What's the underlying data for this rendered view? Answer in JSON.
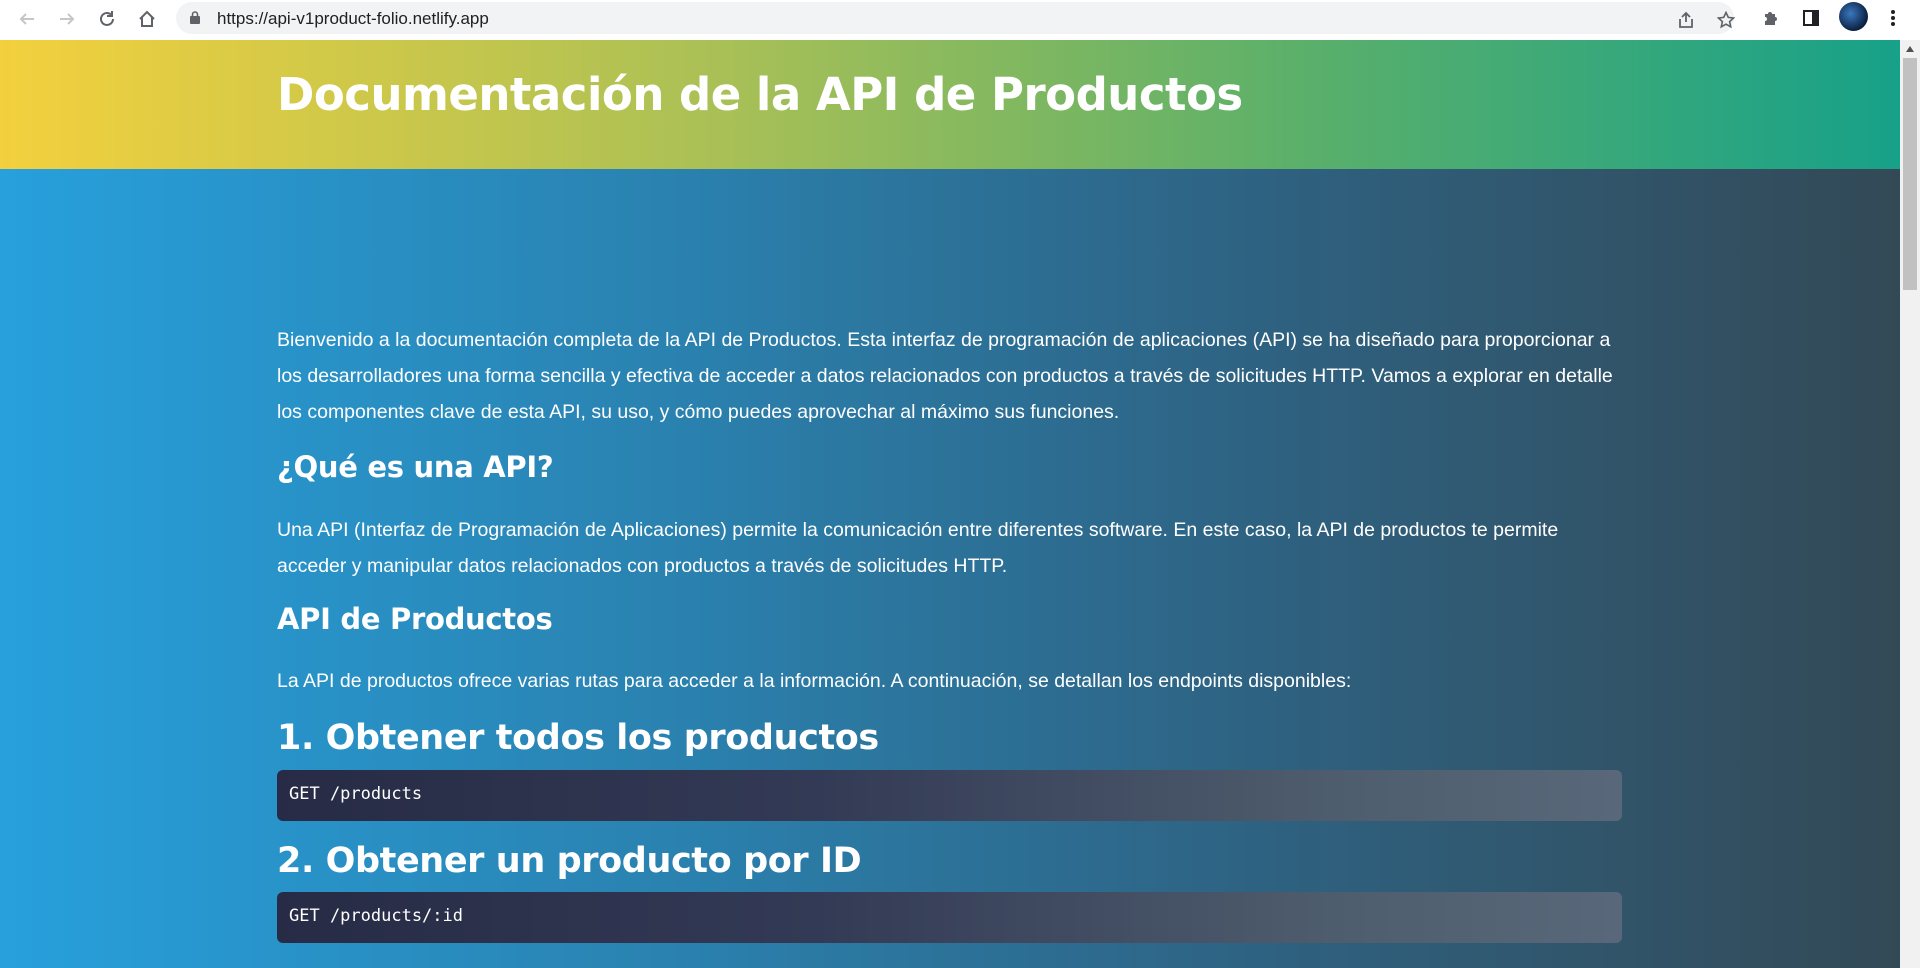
{
  "browser": {
    "url": "https://api-v1product-folio.netlify.app",
    "icons": {
      "back": "arrow-left-icon",
      "forward": "arrow-right-icon",
      "reload": "reload-icon",
      "home": "home-icon",
      "lock": "lock-icon",
      "share": "share-icon",
      "bookmark": "star-icon",
      "extensions": "puzzle-icon",
      "sidepanel": "side-panel-icon",
      "menu": "kebab-menu-icon"
    }
  },
  "page": {
    "title": "Documentación de la API de Productos",
    "intro": "Bienvenido a la documentación completa de la API de Productos. Esta interfaz de programación de aplicaciones (API) se ha diseñado para proporcionar a los desarrolladores una forma sencilla y efectiva de acceder a datos relacionados con productos a través de solicitudes HTTP. Vamos a explorar en detalle los componentes clave de esta API, su uso, y cómo puedes aprovechar al máximo sus funciones.",
    "section_what": {
      "heading": "¿Qué es una API?",
      "text": "Una API (Interfaz de Programación de Aplicaciones) permite la comunicación entre diferentes software. En este caso, la API de productos te permite acceder y manipular datos relacionados con productos a través de solicitudes HTTP."
    },
    "section_api": {
      "heading": "API de Productos",
      "text": "La API de productos ofrece varias rutas para acceder a la información. A continuación, se detallan los endpoints disponibles:"
    },
    "endpoints": [
      {
        "heading": "1. Obtener todos los productos",
        "code": "GET /products"
      },
      {
        "heading": "2. Obtener un producto por ID",
        "code": "GET /products/:id"
      }
    ]
  },
  "colors": {
    "header_start": "#f3d03d",
    "header_end": "#17a189",
    "body_start": "#27a0dc",
    "body_end": "#334956"
  }
}
